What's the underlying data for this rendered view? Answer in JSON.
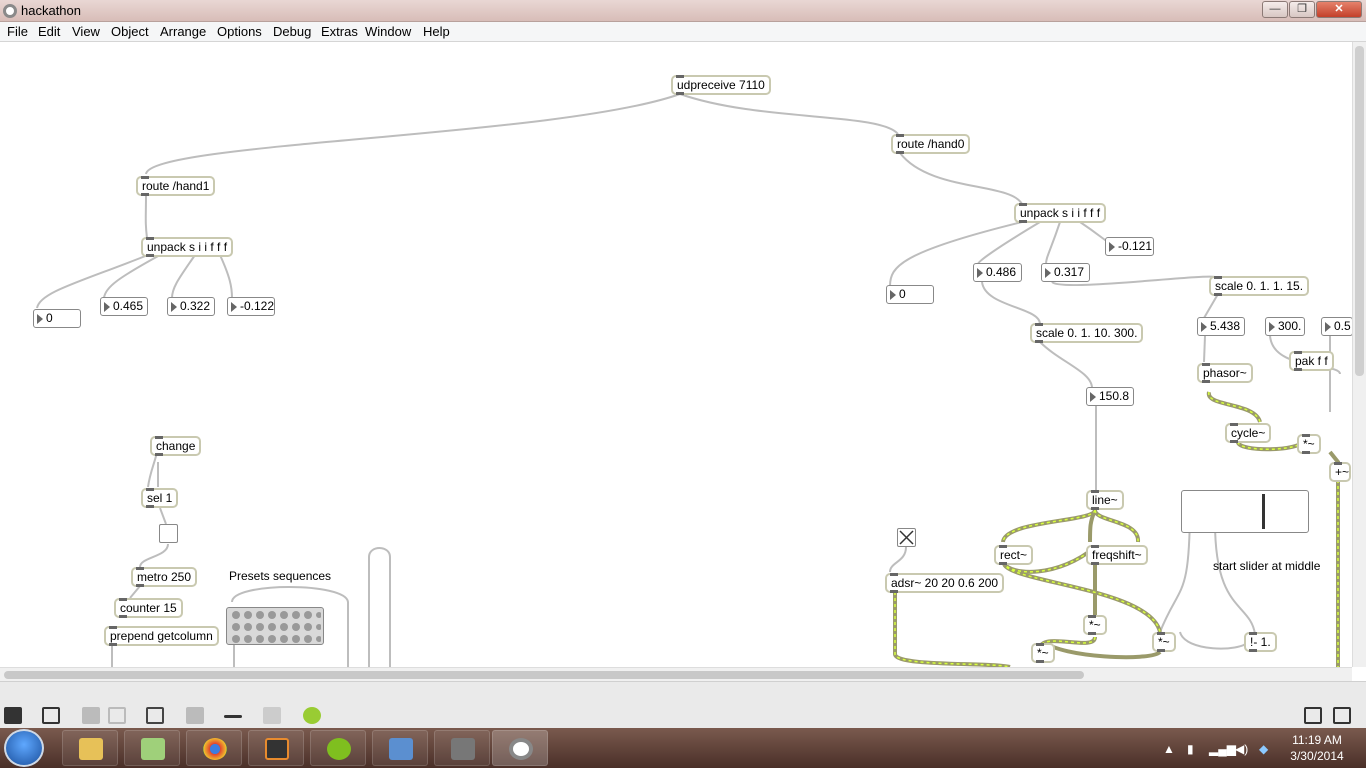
{
  "window": {
    "title": "hackathon",
    "min_label": "—",
    "max_label": "❐",
    "close_label": "✕"
  },
  "menu": [
    "File",
    "Edit",
    "View",
    "Object",
    "Arrange",
    "Options",
    "Debug",
    "Extras",
    "Window",
    "Help"
  ],
  "patch": {
    "objects": {
      "udpreceive": "udpreceive 7110",
      "route_hand1": "route /hand1",
      "route_hand0": "route /hand0",
      "unpack_left": "unpack s i i f f f",
      "unpack_right": "unpack s i i f f f",
      "scale_a": "scale 0. 1. 1. 15.",
      "scale_b": "scale 0. 1. 10. 300.",
      "pak": "pak f f",
      "phasor": "phasor~",
      "cycle": "cycle~",
      "mult_a": "*~",
      "plus": "+~",
      "line": "line~",
      "rect": "rect~",
      "freqshift": "freqshift~",
      "adsr": "adsr~ 20 20 0.6 200",
      "mult_b": "*~",
      "mult_c": "*~",
      "mult_d": "*~",
      "rminus": "!- 1.",
      "change": "change",
      "sel": "sel 1",
      "metro": "metro 250",
      "counter": "counter 15",
      "prepend": "prepend getcolumn"
    },
    "numbers": {
      "left_0": "0",
      "left_1": "0.465",
      "left_2": "0.322",
      "left_3": "-0.122",
      "right_0": "0",
      "right_1": "0.486",
      "right_2": "0.317",
      "right_3": "-0.121",
      "scale_a_out": "5.438",
      "num_300": "300.",
      "num_05": "0.5",
      "scale_b_out": "150.8"
    },
    "comments": {
      "presets": "Presets sequences",
      "slider_note": "start slider at middle"
    },
    "slider_level_percent": 65
  },
  "taskbar": {
    "time": "11:19 AM",
    "date": "3/30/2014"
  }
}
